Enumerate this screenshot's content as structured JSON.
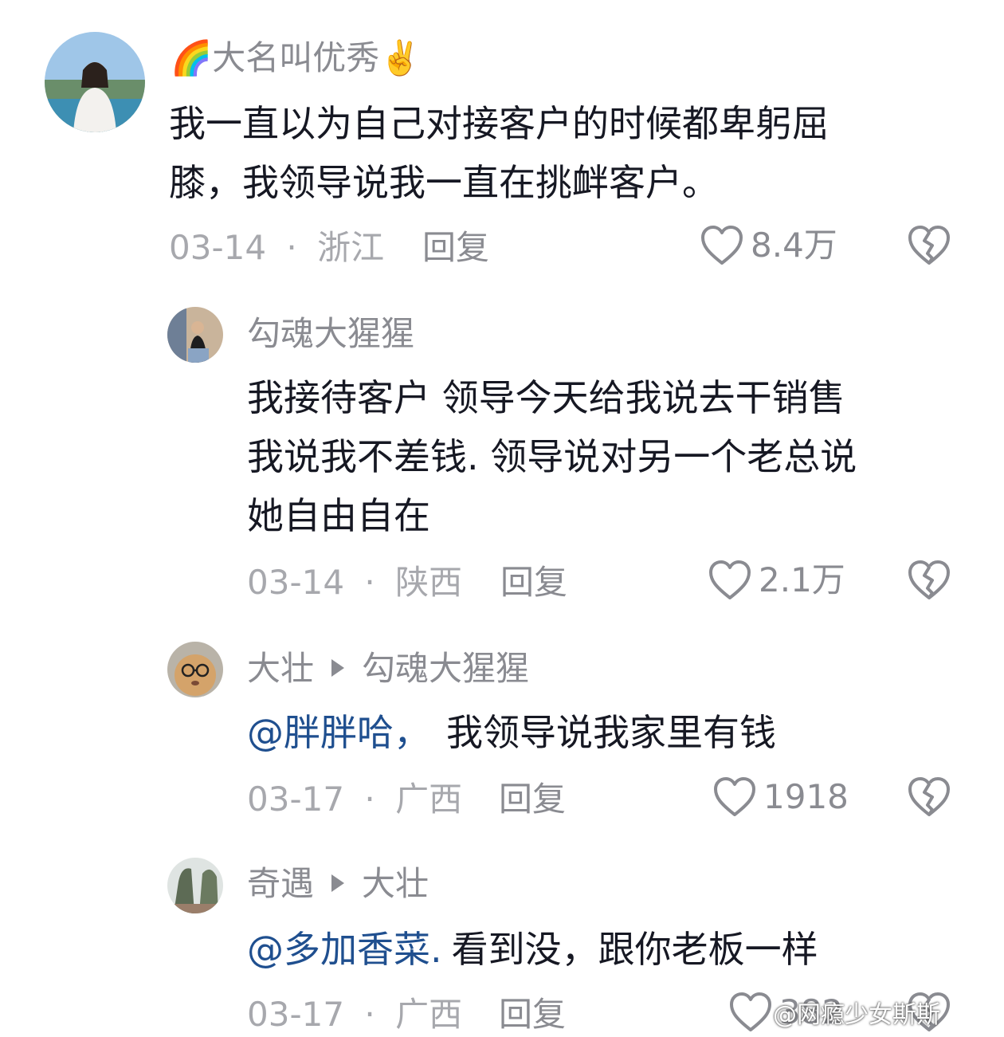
{
  "comments": [
    {
      "user": "大名叫优秀",
      "user_prefix_emoji": "🌈",
      "user_suffix_emoji": "✌️",
      "text_lines": [
        "我一直以为自己对接客户的时候都卑躬屈",
        "膝，我领导说我一直在挑衅客户。"
      ],
      "date": "03-14",
      "separator": "·",
      "location": "浙江",
      "reply_label": "回复",
      "likes": "8.4万"
    },
    {
      "user": "勾魂大猩猩",
      "text_lines": [
        "我接待客户 领导今天给我说去干销售",
        "我说我不差钱. 领导说对另一个老总说",
        "她自由自在"
      ],
      "date": "03-14",
      "separator": "·",
      "location": "陕西",
      "reply_label": "回复",
      "likes": "2.1万"
    },
    {
      "user": "大壮",
      "reply_to": "勾魂大猩猩",
      "mention": "@胖胖哈，",
      "text": "我领导说我家里有钱",
      "date": "03-17",
      "separator": "·",
      "location": "广西",
      "reply_label": "回复",
      "likes": "1918"
    },
    {
      "user": "奇遇",
      "reply_to": "大壮",
      "mention": "@多加香菜.",
      "text": "看到没，跟你老板一样",
      "date": "03-17",
      "separator": "·",
      "location": "广西",
      "reply_label": "回复",
      "likes": "382"
    }
  ],
  "watermark": "@网瘾少女斯斯",
  "colors": {
    "text": "#161823",
    "meta": "#a7a8ad",
    "name": "#8a8b91",
    "mention": "#1f4f8f"
  },
  "icons": {
    "like": "heart-outline-icon",
    "dislike": "broken-heart-icon",
    "reply_arrow": "triangle-right-icon"
  }
}
